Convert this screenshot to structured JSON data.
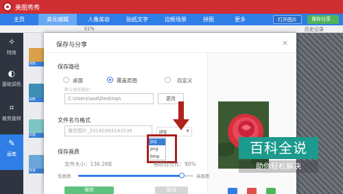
{
  "app": {
    "title": "美图秀秀"
  },
  "nav": {
    "tabs": [
      {
        "label": "主页"
      },
      {
        "label": "美化编辑"
      },
      {
        "label": "人像美容"
      },
      {
        "label": "贴纸文字"
      },
      {
        "label": "边框场景"
      },
      {
        "label": "拼图"
      },
      {
        "label": "更多"
      }
    ],
    "open_image": "打开图片",
    "save_share": "保存分享"
  },
  "toolbar": {
    "zoom": "31%",
    "history": "历史记录"
  },
  "sidebar": {
    "items": [
      {
        "label": "特效",
        "icon": "magic-wand-icon"
      },
      {
        "label": "基础调色",
        "icon": "palette-icon"
      },
      {
        "label": "裁剪旋转",
        "icon": "crop-icon"
      },
      {
        "label": "画笔",
        "icon": "brush-icon"
      }
    ]
  },
  "effects": {
    "labels": [
      "涂鸦",
      "清新",
      "白底",
      "背景"
    ]
  },
  "dialog": {
    "title": "保存与分享",
    "close": "×",
    "save_path": {
      "heading": "保存路径",
      "options": [
        {
          "label": "桌面",
          "selected": false
        },
        {
          "label": "覆盖原图",
          "selected": true
        },
        {
          "label": "自定义",
          "selected": false
        }
      ],
      "hint": "默认保存路径：",
      "path_value": "C:\\Users\\asd\\Desktop\\",
      "change_button": "更改"
    },
    "file": {
      "heading": "文件名与格式",
      "name_value": "微信图片_20180303143536",
      "format_selected": "jpg",
      "format_options": [
        "jpg",
        "png",
        "bmp"
      ]
    },
    "quality": {
      "heading": "保存画质",
      "file_size": "文件大小：136.2KB",
      "quality_percent": "画质百分比：90%",
      "low": "低画质",
      "high": "高画质",
      "level": 0.9
    },
    "actions": {
      "save": "保存",
      "cancel": "取消"
    }
  },
  "watermark": {
    "main": "百科全说",
    "sub": "助你轻松解决"
  },
  "colors": {
    "title_red": "#cf2e33",
    "nav_blue": "#2f7ee6",
    "highlight_red": "#a8201b",
    "watermark_teal": "#1c9a8d"
  }
}
